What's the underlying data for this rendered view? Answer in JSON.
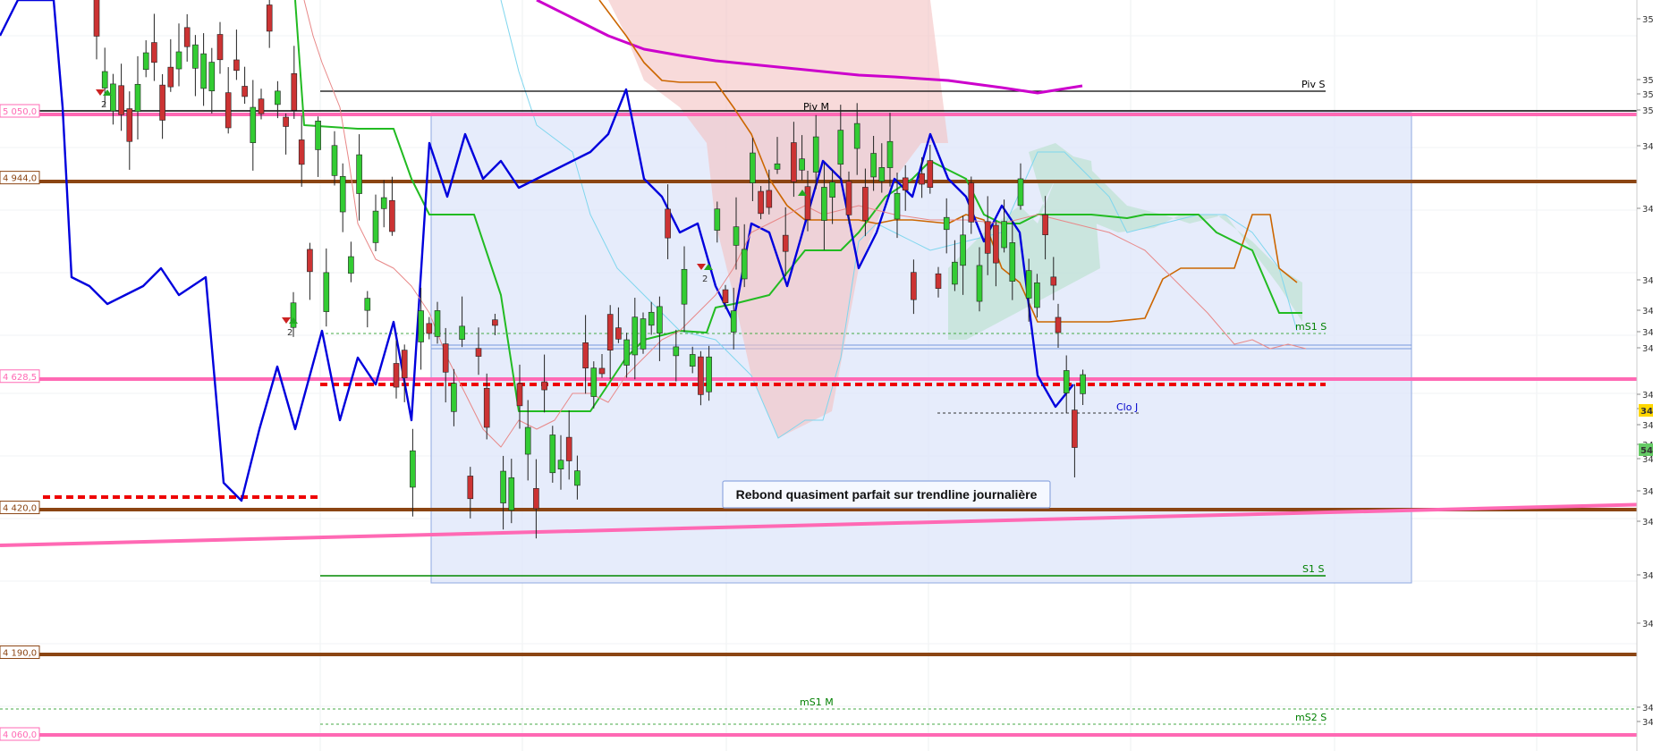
{
  "chart_data": {
    "type": "candlestick",
    "annotation": "Rebond quasiment parfait sur trendline journalière",
    "level_labels": [
      {
        "text": "5 050,0",
        "value": 5050,
        "color": "#ff69b4"
      },
      {
        "text": "4 944,0",
        "value": 4944,
        "color": "#8b4513"
      },
      {
        "text": "4 628,5",
        "value": 4628.5,
        "color": "#ff69b4"
      },
      {
        "text": "4 420,0",
        "value": 4420,
        "color": "#8b4513"
      },
      {
        "text": "4 190,0",
        "value": 4190,
        "color": "#8b4513"
      },
      {
        "text": "4 060,0",
        "value": 4060,
        "color": "#ff69b4"
      }
    ],
    "pivot_labels": [
      {
        "text": "Piv S",
        "value": 5090,
        "color": "#000000"
      },
      {
        "text": "Piv M",
        "value": 5060,
        "color": "#000000"
      },
      {
        "text": "mS1 S",
        "value": 4700,
        "color": "#008000"
      },
      {
        "text": "Clo J",
        "value": 4580,
        "color": "#0000cc"
      },
      {
        "text": "S1 S",
        "value": 4375,
        "color": "#008000"
      },
      {
        "text": "mS1 M",
        "value": 4110,
        "color": "#008000"
      },
      {
        "text": "mS2 S",
        "value": 4085,
        "color": "#008000"
      }
    ],
    "right_axis_ticks": [
      "35",
      "35",
      "35",
      "35",
      "34",
      "34",
      "34",
      "34",
      "34",
      "34",
      "34",
      "34",
      "34",
      "34",
      "34",
      "34",
      "34",
      "34",
      "34",
      "34",
      "34"
    ],
    "price_tags": [
      {
        "text": "34",
        "bg": "#ffd700"
      },
      {
        "text": "54",
        "bg": "#66cc66"
      }
    ],
    "signal_marker": "2",
    "colors": {
      "pink_level": "#ff69b4",
      "brown_level": "#8b4513",
      "ichimoku_red_cloud": "#f4c2c2",
      "ichimoku_green_cloud": "#b2e0c6",
      "selection_box": "#dde6fa",
      "bull_candle": "#33cc33",
      "bear_candle": "#cc3333",
      "blue_indicator": "#0000dd",
      "green_line": "#22bb22",
      "orange_line": "#cc6600",
      "magenta_ma": "#cc00cc"
    }
  }
}
